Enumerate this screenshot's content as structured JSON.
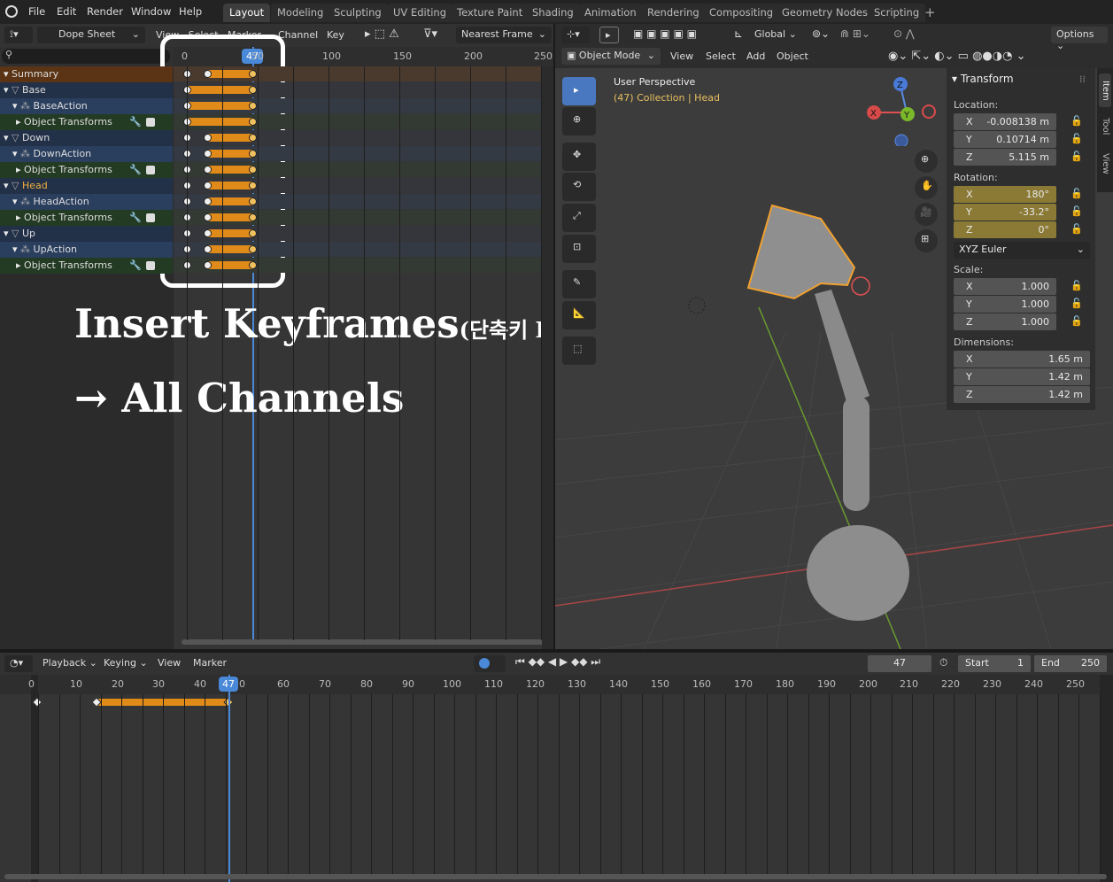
{
  "menu": {
    "file": "File",
    "edit": "Edit",
    "render": "Render",
    "window": "Window",
    "help": "Help"
  },
  "workspaces": [
    "Layout",
    "Modeling",
    "Sculpting",
    "UV Editing",
    "Texture Paint",
    "Shading",
    "Animation",
    "Rendering",
    "Compositing",
    "Geometry Nodes",
    "Scripting"
  ],
  "dopesheet": {
    "mode": "Dope Sheet",
    "menus": [
      "View",
      "Select",
      "Marker",
      "Channel",
      "Key"
    ],
    "snap": "Nearest Frame",
    "current_frame": "47",
    "ruler": [
      "0",
      "50",
      "100",
      "150",
      "200",
      "250"
    ],
    "channels": [
      {
        "label": "Summary",
        "kind": "summary"
      },
      {
        "label": "Base",
        "kind": "object"
      },
      {
        "label": "BaseAction",
        "kind": "action"
      },
      {
        "label": "Object Transforms",
        "kind": "group"
      },
      {
        "label": "Down",
        "kind": "object"
      },
      {
        "label": "DownAction",
        "kind": "action"
      },
      {
        "label": "Object Transforms",
        "kind": "group"
      },
      {
        "label": "Head",
        "kind": "object-active"
      },
      {
        "label": "HeadAction",
        "kind": "action"
      },
      {
        "label": "Object Transforms",
        "kind": "group"
      },
      {
        "label": "Up",
        "kind": "object"
      },
      {
        "label": "UpAction",
        "kind": "action"
      },
      {
        "label": "Object Transforms",
        "kind": "group"
      }
    ]
  },
  "overlay": {
    "line1": "Insert Keyframes",
    "line1_small": "(단축키 I)",
    "line2": "→ All Channels"
  },
  "viewport": {
    "mode": "Object Mode",
    "menus": [
      "View",
      "Select",
      "Add",
      "Object"
    ],
    "orientation": "Global",
    "options": "Options",
    "perspective": "User Perspective",
    "collection": "(47) Collection | Head",
    "gizmo": {
      "x": "X",
      "y": "Y",
      "z": "Z"
    }
  },
  "transform": {
    "title": "Transform",
    "location_label": "Location:",
    "location": [
      {
        "axis": "X",
        "value": "-0.008138 m"
      },
      {
        "axis": "Y",
        "value": "0.10714 m"
      },
      {
        "axis": "Z",
        "value": "5.115 m"
      }
    ],
    "rotation_label": "Rotation:",
    "rotation": [
      {
        "axis": "X",
        "value": "180°"
      },
      {
        "axis": "Y",
        "value": "-33.2°"
      },
      {
        "axis": "Z",
        "value": "0°"
      }
    ],
    "rotation_mode": "XYZ Euler",
    "scale_label": "Scale:",
    "scale": [
      {
        "axis": "X",
        "value": "1.000"
      },
      {
        "axis": "Y",
        "value": "1.000"
      },
      {
        "axis": "Z",
        "value": "1.000"
      }
    ],
    "dimensions_label": "Dimensions:",
    "dimensions": [
      {
        "axis": "X",
        "value": "1.65 m"
      },
      {
        "axis": "Y",
        "value": "1.42 m"
      },
      {
        "axis": "Z",
        "value": "1.42 m"
      }
    ]
  },
  "side_tabs": [
    "Item",
    "Tool",
    "View"
  ],
  "timeline": {
    "playback": "Playback",
    "keying": "Keying",
    "view": "View",
    "marker": "Marker",
    "frame": "47",
    "start_label": "Start",
    "start": "1",
    "end_label": "End",
    "end": "250",
    "ruler": [
      "0",
      "10",
      "20",
      "30",
      "40",
      "47",
      "0",
      "60",
      "70",
      "80",
      "90",
      "100",
      "110",
      "120",
      "130",
      "140",
      "150",
      "160",
      "170",
      "180",
      "190",
      "200",
      "210",
      "220",
      "230",
      "240",
      "250"
    ]
  }
}
